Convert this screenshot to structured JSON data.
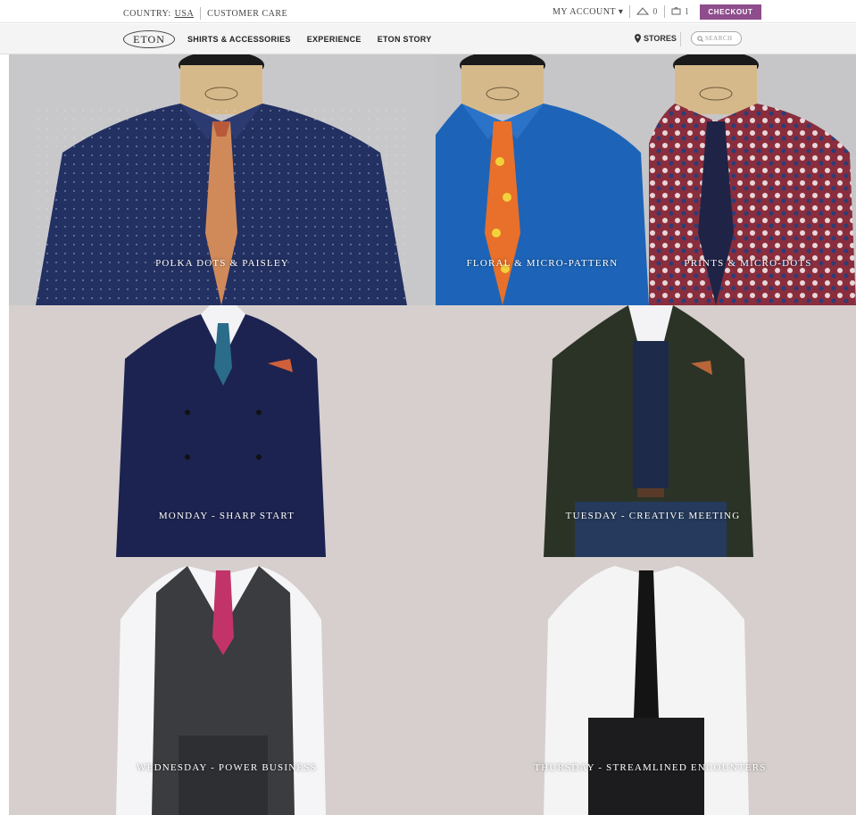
{
  "topbar": {
    "country_label": "COUNTRY:",
    "country_value": "USA",
    "customer_care": "CUSTOMER CARE",
    "my_account": "MY ACCOUNT ▾",
    "wishlist_count": "0",
    "bag_count": "1",
    "checkout": "CHECKOUT"
  },
  "nav": {
    "logo": "ETON",
    "links": [
      "SHIRTS & ACCESSORIES",
      "EXPERIENCE",
      "ETON STORY"
    ],
    "stores": "STORES",
    "search_placeholder": "SEARCH"
  },
  "collections": [
    {
      "caption": "POLKA DOTS & PAISLEY",
      "shirt": "#233062",
      "tie": "#d08a5a"
    },
    {
      "caption": "FLORAL & MICRO-PATTERN",
      "shirt": "#1d64b8",
      "tie": "#e8702a"
    },
    {
      "caption": "PRINTS & MICRO-DOTS",
      "shirt": "#8a2d3c",
      "tie": "#1f2447"
    }
  ],
  "looks": [
    {
      "caption": "MONDAY - SHARP START",
      "jacket": "#1c2350",
      "tie": "#2a6c8a"
    },
    {
      "caption": "TUESDAY - CREATIVE MEETING",
      "jacket": "#2b3326",
      "tie": "#1e2a4a"
    },
    {
      "caption": "WEDNESDAY - POWER BUSINESS",
      "jacket": "#3a3c3f",
      "tie": "#c2336a"
    },
    {
      "caption": "THURSDAY - STREAMLINED ENCOUNTERS",
      "jacket": "#f4f4f4",
      "tie": "#141414"
    }
  ],
  "colors": {
    "accent": "#8e4d8d"
  }
}
